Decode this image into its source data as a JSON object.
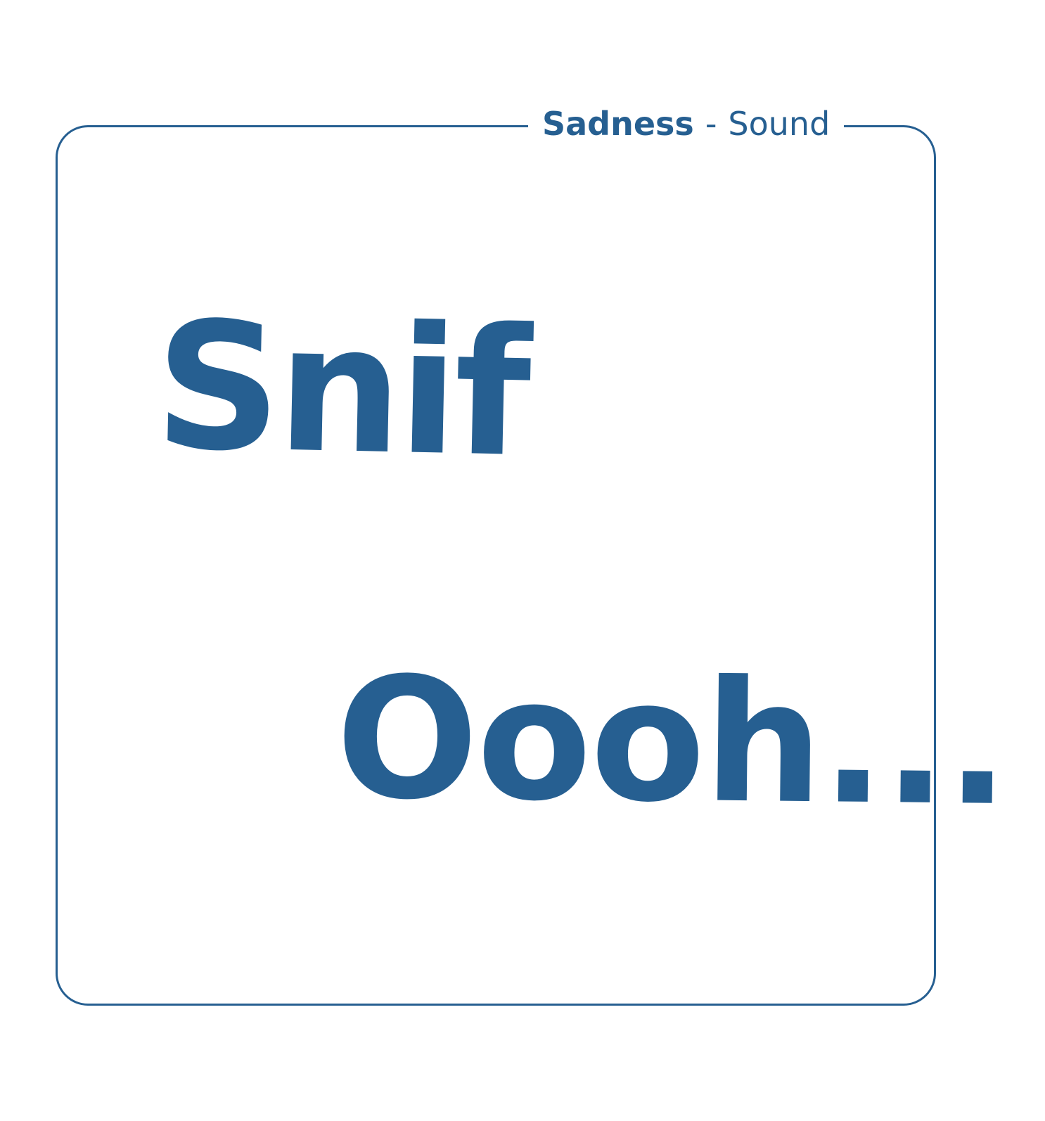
{
  "header": {
    "category": "Sadness",
    "separator": "-",
    "type": "Sound"
  },
  "words": {
    "first": "Snif",
    "second": "Oooh..."
  },
  "colors": {
    "accent": "#265f91",
    "background": "#ffffff"
  }
}
